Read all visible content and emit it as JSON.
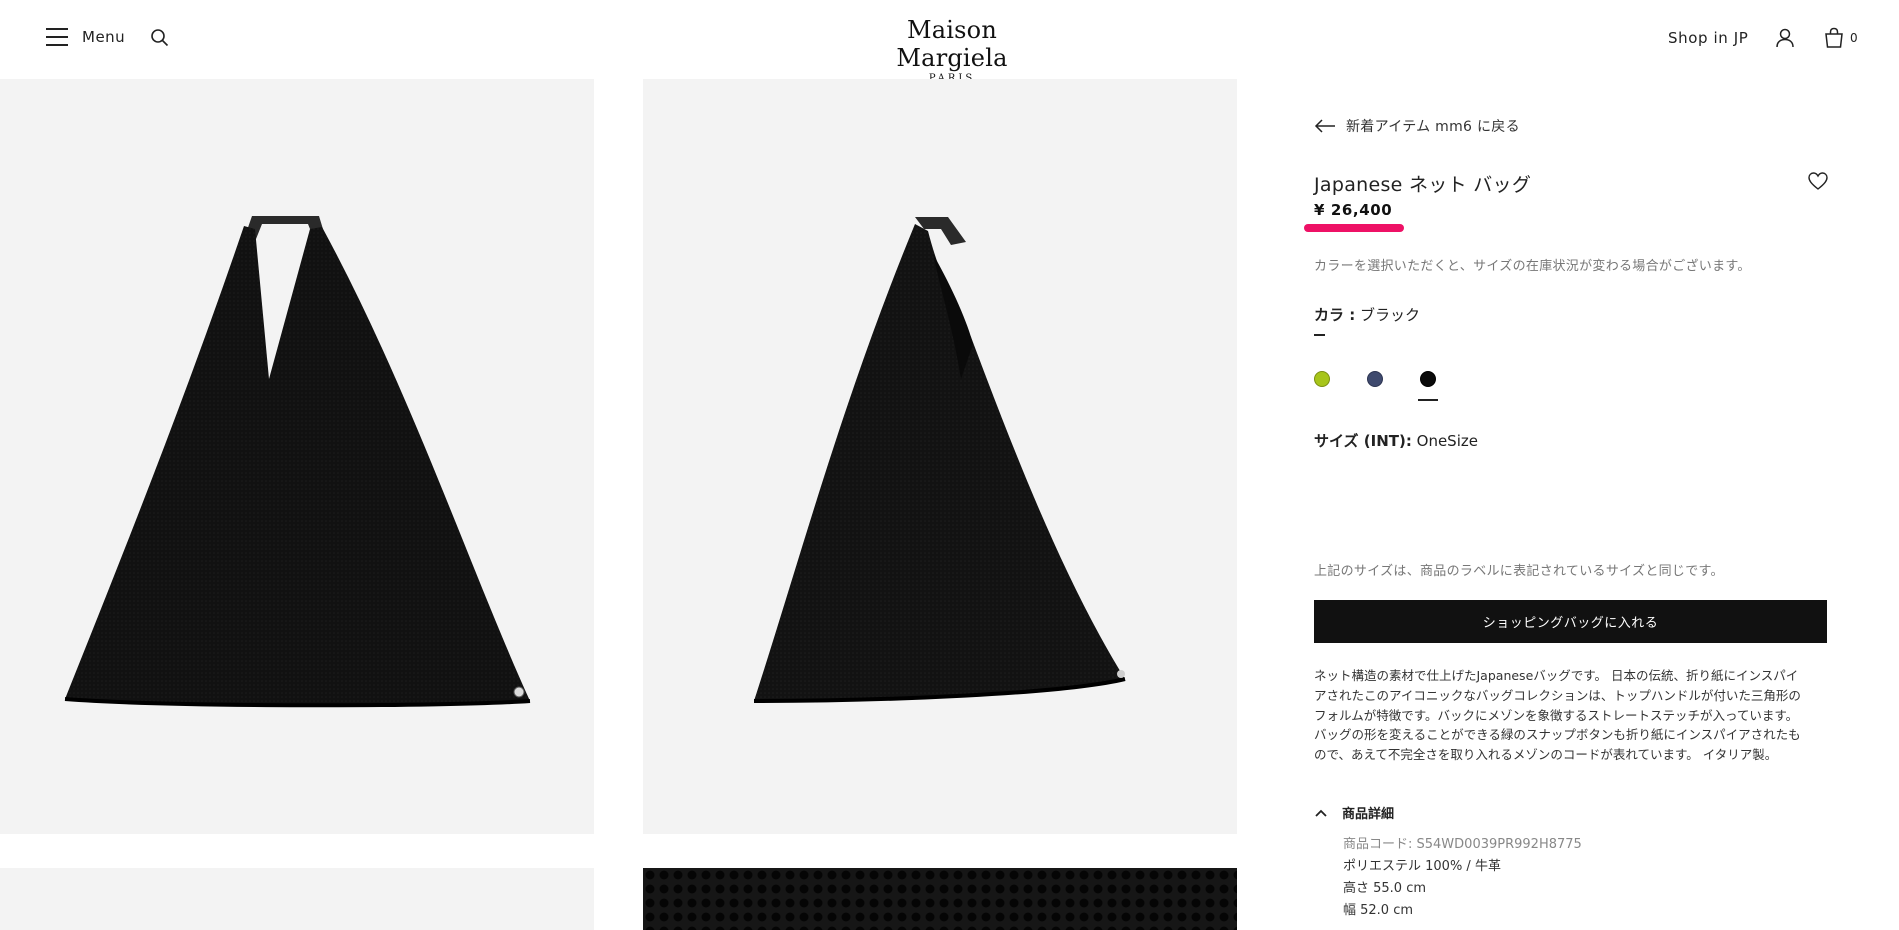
{
  "header": {
    "menu_label": "Menu",
    "logo_main": "Maison Margiela",
    "logo_sub": "PARIS",
    "shop_in_label": "Shop in JP",
    "cart_count": "0",
    "icons": [
      "hamburger-icon",
      "search-icon",
      "user-icon",
      "bag-icon"
    ]
  },
  "product": {
    "back_label": "新着アイテム mm6 に戻る",
    "title": "Japanese ネット バッグ",
    "price": "¥ 26,400",
    "color_note": "カラーを選択いただくと、サイズの在庫状況が変わる場合がございます。",
    "color_label": "カラ :",
    "color_value": "ブラック",
    "swatches": [
      {
        "name": "lime",
        "color": "#a7c51a"
      },
      {
        "name": "navy",
        "color": "#3f4a6e"
      },
      {
        "name": "black",
        "color": "#0a0a0a",
        "selected": true
      }
    ],
    "size_label": "サイズ (INT):",
    "size_value": "OneSize",
    "size_note": "上記のサイズは、商品のラベルに表記されているサイズと同じです。",
    "add_to_bag": "ショッピングバッグに入れる",
    "description": [
      "ネット構造の素材で仕上げたJapaneseバッグです。 日本の伝統、折り紙にインスパイ",
      "アされたこのアイコニックなバッグコレクションは、トップハンドルが付いた三角形の",
      "フォルムが特徴です。バックにメゾンを象徴するストレートステッチが入っています。",
      "バッグの形を変えることができる緑のスナップボタンも折り紙にインスパイアされたも",
      "ので、あえて不完全さを取り入れるメゾンのコードが表れています。 イタリア製。"
    ],
    "details_label": "商品詳細",
    "details": {
      "code": "商品コード: S54WD0039PR992H8775",
      "material": "ポリエステル 100% / 牛革",
      "height": "高さ 55.0 cm",
      "width": "幅 52.0 cm"
    }
  },
  "colors": {
    "accent_underline": "#ee1166",
    "button_bg": "#111111",
    "image_bg": "#f3f3f3"
  }
}
